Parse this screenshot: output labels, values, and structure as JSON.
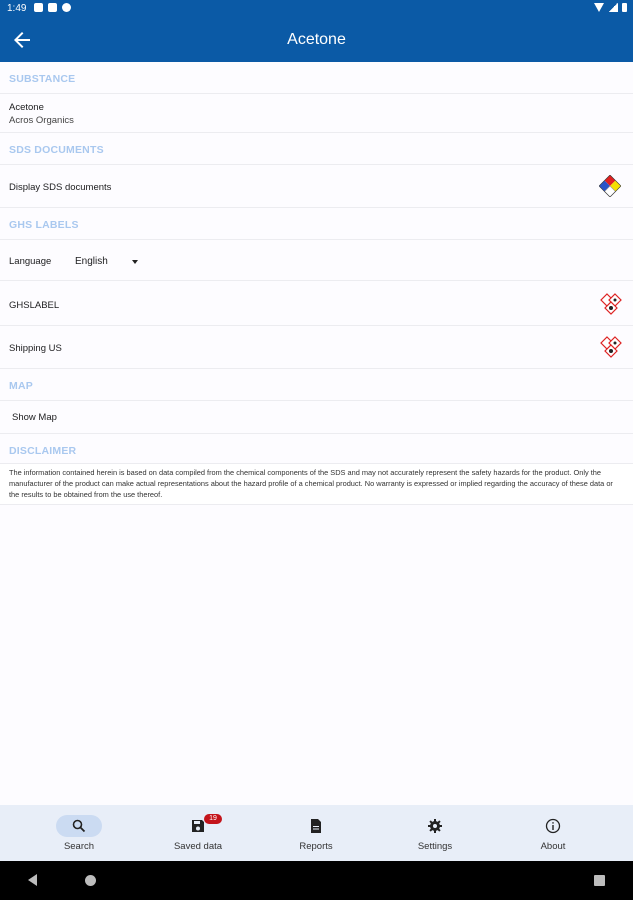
{
  "status_bar": {
    "time": "1:49"
  },
  "app_bar": {
    "title": "Acetone"
  },
  "sections": {
    "substance": "SUBSTANCE",
    "sds_documents": "SDS DOCUMENTS",
    "ghs_labels": "GHS LABELS",
    "map": "MAP",
    "disclaimer": "DISCLAIMER"
  },
  "substance": {
    "name": "Acetone",
    "supplier": "Acros Organics"
  },
  "sds": {
    "display_label": "Display SDS documents"
  },
  "ghs": {
    "language_label": "Language",
    "language_value": "English",
    "label_1": "GHSLABEL",
    "label_2": "Shipping US"
  },
  "map": {
    "show_map": "Show Map"
  },
  "disclaimer": {
    "text": "The information contained herein is based on data compiled from the chemical components of the SDS and may not accurately represent the safety hazards for the product. Only the manufacturer of the product can make actual representations about the hazard profile of a chemical product. No warranty is expressed or implied regarding the accuracy of these data or the results to be obtained from the use thereof."
  },
  "bottom_nav": {
    "search": "Search",
    "saved_data": "Saved data",
    "saved_badge": "19",
    "reports": "Reports",
    "settings": "Settings",
    "about": "About"
  },
  "colors": {
    "brand": "#0b5aa6",
    "section_header": "#a9c8ef",
    "badge": "#c4141b"
  }
}
